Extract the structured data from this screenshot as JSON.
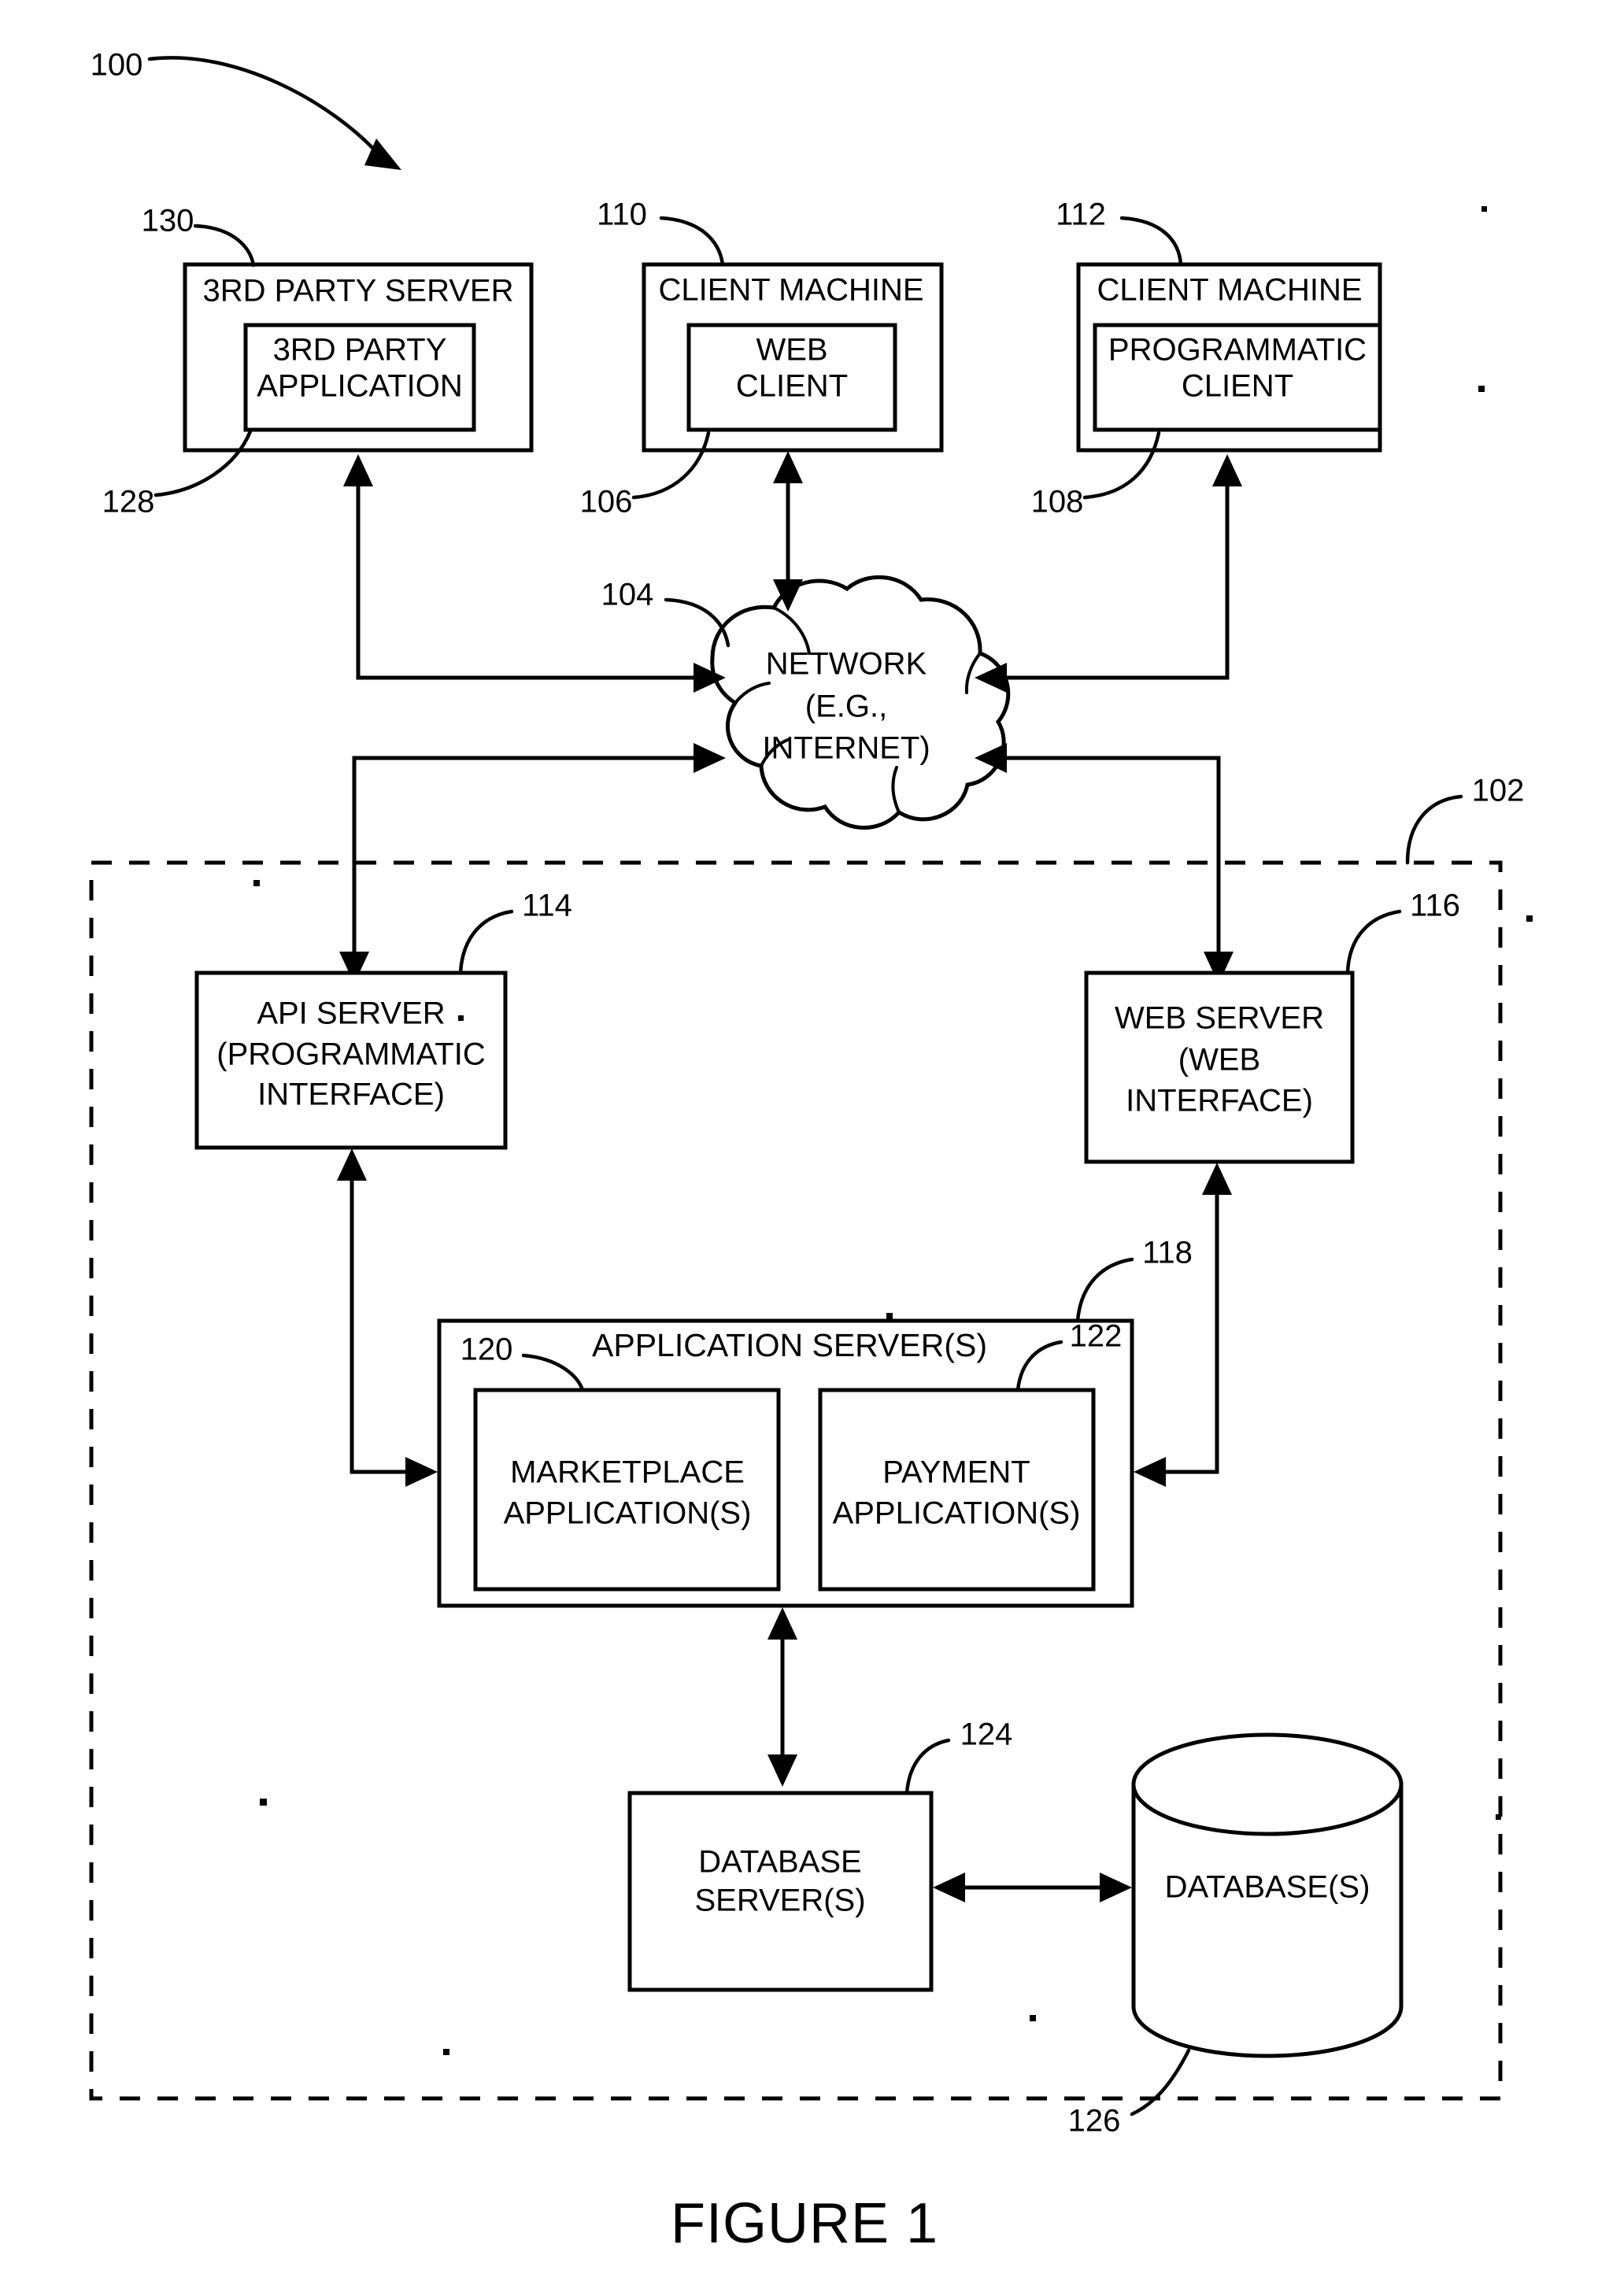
{
  "figure": {
    "caption": "FIGURE 1",
    "system_ref": "100",
    "network_platform_ref": "102"
  },
  "nodes": {
    "third_party_server": {
      "title": "3RD PARTY SERVER",
      "ref": "130",
      "inner": {
        "line1": "3RD PARTY",
        "line2": "APPLICATION",
        "ref": "128"
      }
    },
    "client_machine_web": {
      "title": "CLIENT MACHINE",
      "ref": "110",
      "inner": {
        "line1": "WEB",
        "line2": "CLIENT",
        "ref": "106"
      }
    },
    "client_machine_prog": {
      "title": "CLIENT MACHINE",
      "ref": "112",
      "inner": {
        "line1": "PROGRAMMATIC",
        "line2": "CLIENT",
        "ref": "108"
      }
    },
    "network": {
      "line1": "NETWORK",
      "line2": "(E.G.,",
      "line3": "INTERNET)",
      "ref": "104"
    },
    "api_server": {
      "line1": "API SERVER",
      "line2": "(PROGRAMMATIC",
      "line3": "INTERFACE)",
      "ref": "114"
    },
    "web_server": {
      "line1": "WEB SERVER",
      "line2": "(WEB",
      "line3": "INTERFACE)",
      "ref": "116"
    },
    "application_server": {
      "title": "APPLICATION SERVER(S)",
      "ref": "118"
    },
    "marketplace_application": {
      "line1": "MARKETPLACE",
      "line2": "APPLICATION(S)",
      "ref": "120"
    },
    "payment_application": {
      "line1": "PAYMENT",
      "line2": "APPLICATION(S)",
      "ref": "122"
    },
    "database_server": {
      "line1": "DATABASE",
      "line2": "SERVER(S)",
      "ref": "124"
    },
    "databases": {
      "label": "DATABASE(S)",
      "ref": "126"
    }
  },
  "colors": {
    "ink": "#000000",
    "paper": "#ffffff"
  }
}
